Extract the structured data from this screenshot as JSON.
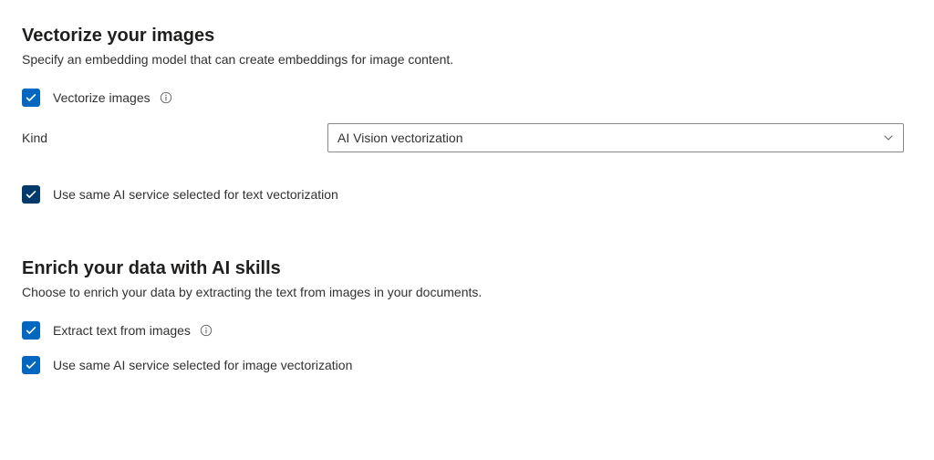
{
  "vectorize": {
    "title": "Vectorize your images",
    "description": "Specify an embedding model that can create embeddings for image content.",
    "checkbox1_label": "Vectorize images",
    "kind_label": "Kind",
    "kind_value": "AI Vision vectorization",
    "checkbox2_label": "Use same AI service selected for text vectorization"
  },
  "enrich": {
    "title": "Enrich your data with AI skills",
    "description": "Choose to enrich your data by extracting the text from images in your documents.",
    "checkbox1_label": "Extract text from images",
    "checkbox2_label": "Use same AI service selected for image vectorization"
  }
}
